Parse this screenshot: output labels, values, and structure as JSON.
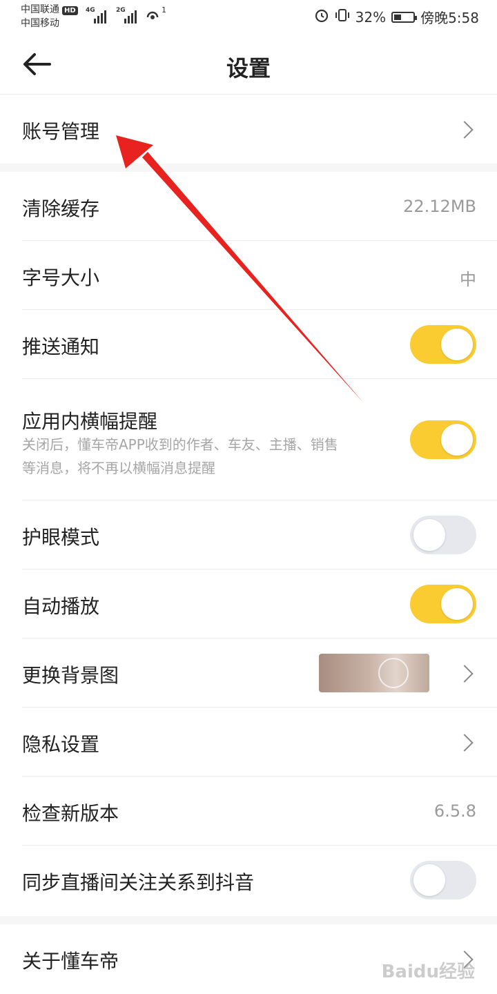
{
  "status_bar": {
    "carrier1": "中国联通",
    "carrier1_badge": "HD",
    "carrier2": "中国移动",
    "net1": "4G",
    "net2": "2G",
    "hotspot_count": "1",
    "battery": "32%",
    "time": "傍晚5:58",
    "icons": [
      "alarm-icon",
      "vibrate-icon",
      "battery-icon",
      "wifi-hotspot-icon",
      "signal-icon"
    ]
  },
  "header": {
    "title": "设置",
    "back_icon": "arrow-left-icon"
  },
  "settings": {
    "account": "账号管理",
    "clear_cache": "清除缓存",
    "cache_size": "22.12MB",
    "font_size": "字号大小",
    "font_size_value": "中",
    "push": "推送通知",
    "banner": "应用内横幅提醒",
    "banner_desc_line1": "关闭后，懂车帝APP收到的作者、车友、主播、销售",
    "banner_desc_line2": "等消息，将不再以横幅消息提醒",
    "eye_mode": "护眼模式",
    "autoplay": "自动播放",
    "background": "更换背景图",
    "privacy": "隐私设置",
    "check_version": "检查新版本",
    "version": "6.5.8",
    "sync_douyin": "同步直播间关注关系到抖音",
    "about": "关于懂车帝"
  },
  "toggles": {
    "push": true,
    "banner": true,
    "eye_mode": false,
    "autoplay": true,
    "sync_douyin": false
  },
  "colors": {
    "toggle_on": "#fbcc32",
    "toggle_off": "#e6e8ee",
    "annotation_arrow": "#e8231f"
  },
  "watermark": "Baidu经验"
}
